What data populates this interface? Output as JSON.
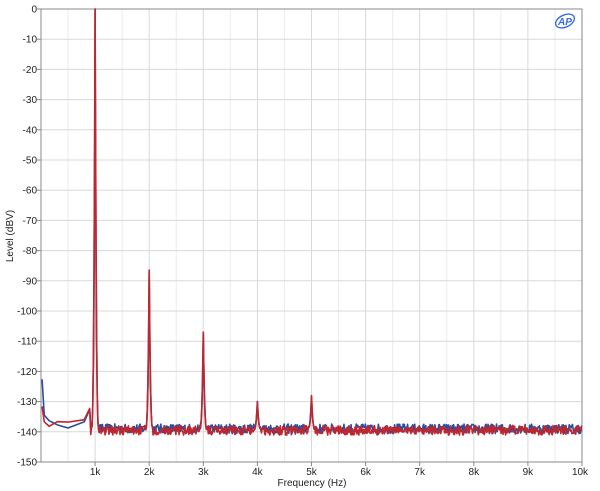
{
  "chart_data": {
    "type": "line",
    "xlabel": "Frequency (Hz)",
    "ylabel": "Level (dBV)",
    "xlim": [
      0,
      10000
    ],
    "ylim": [
      -150,
      0
    ],
    "grid": true,
    "x_ticks": [
      {
        "value": 1000,
        "label": "1k"
      },
      {
        "value": 2000,
        "label": "2k"
      },
      {
        "value": 3000,
        "label": "3k"
      },
      {
        "value": 4000,
        "label": "4k"
      },
      {
        "value": 5000,
        "label": "5k"
      },
      {
        "value": 6000,
        "label": "6k"
      },
      {
        "value": 7000,
        "label": "7k"
      },
      {
        "value": 8000,
        "label": "8k"
      },
      {
        "value": 9000,
        "label": "9k"
      },
      {
        "value": 10000,
        "label": "10k"
      }
    ],
    "y_ticks": [
      {
        "value": 0,
        "label": "0"
      },
      {
        "value": -10,
        "label": "-10"
      },
      {
        "value": -20,
        "label": "-20"
      },
      {
        "value": -30,
        "label": "-30"
      },
      {
        "value": -40,
        "label": "-40"
      },
      {
        "value": -50,
        "label": "-50"
      },
      {
        "value": -60,
        "label": "-60"
      },
      {
        "value": -70,
        "label": "-70"
      },
      {
        "value": -80,
        "label": "-80"
      },
      {
        "value": -90,
        "label": "-90"
      },
      {
        "value": -100,
        "label": "-100"
      },
      {
        "value": -110,
        "label": "-110"
      },
      {
        "value": -120,
        "label": "-120"
      },
      {
        "value": -130,
        "label": "-130"
      },
      {
        "value": -140,
        "label": "-140"
      },
      {
        "value": -150,
        "label": "-150"
      }
    ],
    "series": [
      {
        "color": "#2b4f9e",
        "noise_floor": -139,
        "points": [
          [
            20,
            -122
          ],
          [
            60,
            -135
          ],
          [
            150,
            -137
          ],
          [
            300,
            -137
          ],
          [
            500,
            -138
          ],
          [
            800,
            -136
          ],
          [
            900,
            -133
          ]
        ],
        "peaks": [
          [
            1000,
            0
          ],
          [
            2000,
            -86.5
          ],
          [
            3000,
            -107
          ],
          [
            4000,
            -130
          ],
          [
            5000,
            -128.5
          ]
        ]
      },
      {
        "color": "#c0262d",
        "noise_floor": -139.5,
        "points": [
          [
            20,
            -131
          ],
          [
            60,
            -136
          ],
          [
            150,
            -137.5
          ],
          [
            300,
            -136.5
          ],
          [
            500,
            -137.5
          ],
          [
            800,
            -135.5
          ],
          [
            900,
            -132
          ]
        ],
        "peaks": [
          [
            1000,
            0
          ],
          [
            2000,
            -86.5
          ],
          [
            3000,
            -107
          ],
          [
            4000,
            -130
          ],
          [
            5000,
            -128
          ]
        ]
      }
    ]
  },
  "logo": {
    "text": "AP",
    "color": "#3a6fd8"
  },
  "colors": {
    "grid": "#d8d8d8",
    "frame": "#888888",
    "background": "#ffffff"
  }
}
